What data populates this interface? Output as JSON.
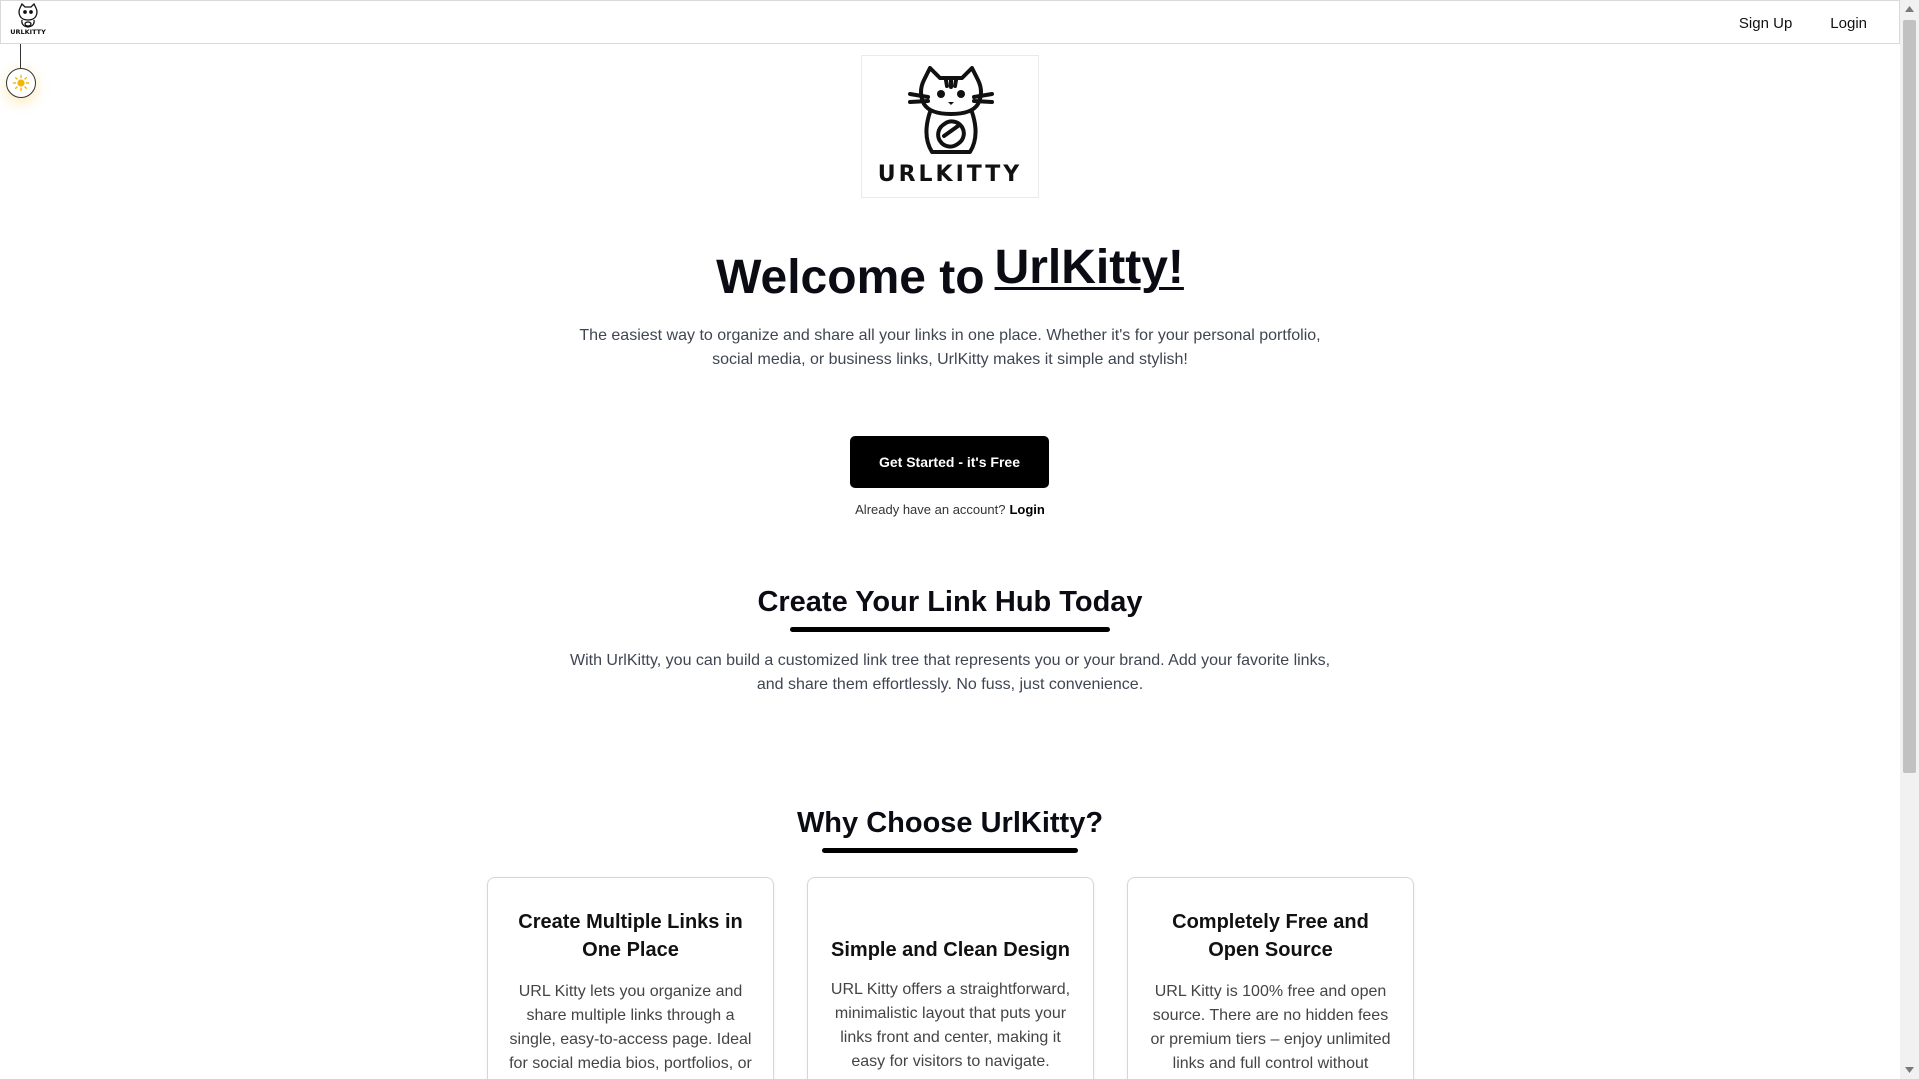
{
  "nav": {
    "logo_text": "URLKITTY",
    "signup_label": "Sign Up",
    "login_label": "Login"
  },
  "theme_toggle": {
    "icon": "sun-icon",
    "accent": "#f2b705"
  },
  "hero": {
    "logo_text": "URLKITTY",
    "headline_prefix": "Welcome to",
    "headline_brand": "UrlKitty!",
    "intro": "The easiest way to organize and share all your links in one place. Whether it's for your personal portfolio, social media, or business links, UrlKitty makes it simple and stylish!",
    "cta_label": "Get Started - it's Free",
    "account_prompt": "Already have an account?",
    "account_login": "Login"
  },
  "link_hub": {
    "title": "Create Your Link Hub Today",
    "text": "With UrlKitty, you can build a customized link tree that represents you or your brand. Add your favorite links, and share them effortlessly. No fuss, just convenience."
  },
  "why": {
    "title": "Why Choose UrlKitty?",
    "cards": [
      {
        "title": "Create Multiple Links in One Place",
        "text": "URL Kitty lets you organize and share multiple links through a single, easy-to-access page. Ideal for social media bios, portfolios, or"
      },
      {
        "title": "Simple and Clean Design",
        "text": "URL Kitty offers a straightforward, minimalistic layout that puts your links front and center, making it easy for visitors to navigate."
      },
      {
        "title": "Completely Free and Open Source",
        "text": "URL Kitty is 100% free and open source. There are no hidden fees or premium tiers – enjoy unlimited links and full control without"
      }
    ]
  },
  "colors": {
    "primary": "#000000",
    "text_muted": "#3f4652",
    "border": "#d6d6d6"
  }
}
